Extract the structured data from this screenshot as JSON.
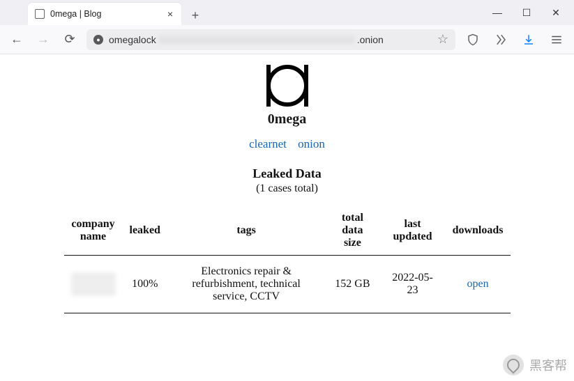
{
  "browser": {
    "tab_title": "0mega | Blog",
    "url_prefix": "omegalock",
    "url_suffix": ".onion"
  },
  "site": {
    "brand": "0mega",
    "nav": {
      "clearnet": "clearnet",
      "onion": "onion"
    },
    "section_title": "Leaked Data",
    "subtitle": "(1 cases total)"
  },
  "table": {
    "headers": {
      "company": "company name",
      "leaked": "leaked",
      "tags": "tags",
      "size": "total data size",
      "updated": "last updated",
      "downloads": "downloads"
    },
    "rows": [
      {
        "company": "",
        "leaked": "100%",
        "tags": "Electronics repair & refurbishment, technical service, CCTV",
        "size": "152 GB",
        "updated": "2022-05-23",
        "downloads": "open"
      }
    ]
  },
  "watermark": "黑客帮"
}
